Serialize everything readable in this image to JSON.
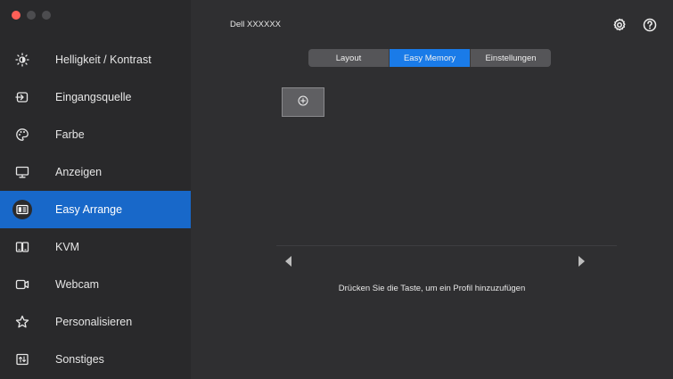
{
  "window": {
    "title": "Dell XXXXXX"
  },
  "sidebar": {
    "items": [
      {
        "label": "Helligkeit / Kontrast",
        "icon": "brightness-icon",
        "active": false
      },
      {
        "label": "Eingangsquelle",
        "icon": "input-source-icon",
        "active": false
      },
      {
        "label": "Farbe",
        "icon": "color-palette-icon",
        "active": false
      },
      {
        "label": "Anzeigen",
        "icon": "monitor-icon",
        "active": false
      },
      {
        "label": "Easy Arrange",
        "icon": "easy-arrange-icon",
        "active": true
      },
      {
        "label": "KVM",
        "icon": "kvm-icon",
        "active": false
      },
      {
        "label": "Webcam",
        "icon": "webcam-icon",
        "active": false
      },
      {
        "label": "Personalisieren",
        "icon": "star-icon",
        "active": false
      },
      {
        "label": "Sonstiges",
        "icon": "others-icon",
        "active": false
      }
    ]
  },
  "header": {
    "icons": [
      "settings-gear-icon",
      "help-icon"
    ]
  },
  "tabs": [
    {
      "label": "Layout",
      "active": false
    },
    {
      "label": "Easy Memory",
      "active": true
    },
    {
      "label": "Einstellungen",
      "active": false
    }
  ],
  "main": {
    "hint": "Drücken Sie die Taste, um ein Profil hinzuzufügen"
  },
  "colors": {
    "accent": "#1868c9",
    "tab_active": "#1a7be8",
    "background": "#2f2f31",
    "sidebar": "#29292b"
  }
}
